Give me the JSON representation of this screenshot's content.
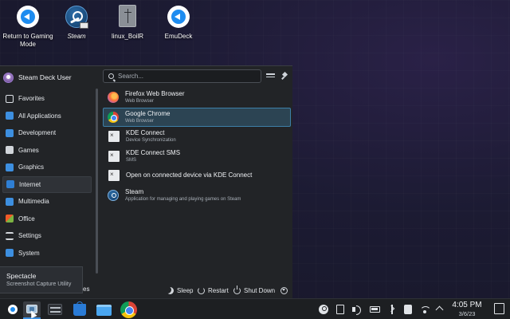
{
  "desktop": {
    "icons": [
      {
        "label": "Return to Gaming Mode",
        "icon": "emudeck-return-icon"
      },
      {
        "label": "Steam",
        "icon": "steam-icon"
      },
      {
        "label": "linux_BoilR",
        "icon": "file-icon"
      },
      {
        "label": "EmuDeck",
        "icon": "emudeck-icon"
      }
    ]
  },
  "launcher": {
    "user_name": "Steam Deck User",
    "search_placeholder": "Search...",
    "categories": [
      {
        "label": "Favorites"
      },
      {
        "label": "All Applications"
      },
      {
        "label": "Development"
      },
      {
        "label": "Games"
      },
      {
        "label": "Graphics"
      },
      {
        "label": "Internet"
      },
      {
        "label": "Multimedia"
      },
      {
        "label": "Office"
      },
      {
        "label": "Settings"
      },
      {
        "label": "System"
      }
    ],
    "active_category": "Internet",
    "apps": [
      {
        "title": "Firefox Web Browser",
        "subtitle": "Web Browser"
      },
      {
        "title": "Google Chrome",
        "subtitle": "Web Browser"
      },
      {
        "title": "KDE Connect",
        "subtitle": "Device Synchronization"
      },
      {
        "title": "KDE Connect SMS",
        "subtitle": "SMS"
      },
      {
        "title": "Open on connected device via KDE Connect",
        "subtitle": ""
      },
      {
        "title": "Steam",
        "subtitle": "Application for managing and playing games on Steam"
      }
    ],
    "selected_app": "Google Chrome",
    "footer": {
      "partial_label": "es",
      "sleep": "Sleep",
      "restart": "Restart",
      "shutdown": "Shut Down"
    }
  },
  "tooltip": {
    "title": "Spectacle",
    "subtitle": "Screenshot Capture Utility"
  },
  "taskbar": {
    "time": "4:05 PM",
    "date": "3/6/23"
  },
  "colors": {
    "accent": "#3d8fe0",
    "selected_bg": "#2c4453",
    "panel_bg": "#222427"
  }
}
